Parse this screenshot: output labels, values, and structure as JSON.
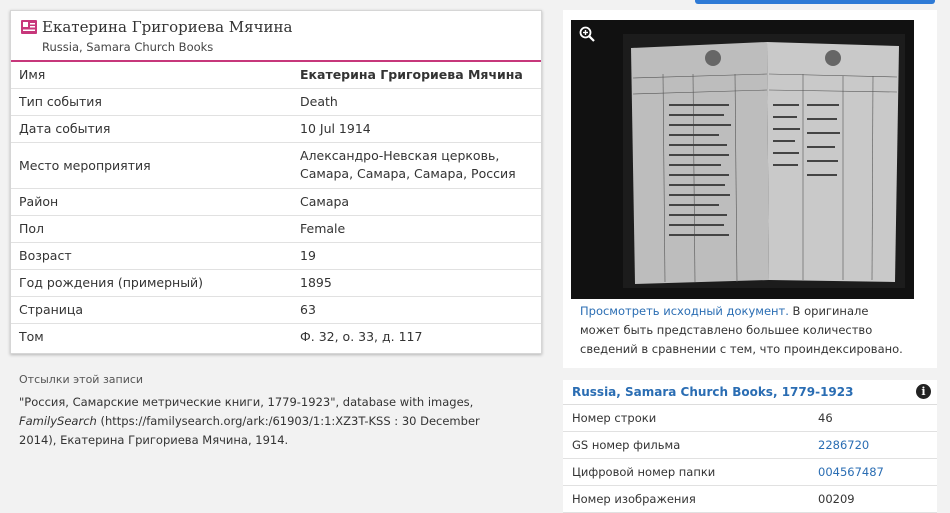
{
  "record": {
    "title": "Екатерина Григориева Мячина",
    "subtitle": "Russia, Samara Church Books",
    "fields": [
      {
        "label": "Имя",
        "value": "Екатерина Григориева Мячина"
      },
      {
        "label": "Тип события",
        "value": "Death"
      },
      {
        "label": "Дата события",
        "value": "10 Jul 1914"
      },
      {
        "label": "Место мероприятия",
        "value": "Александро-Невская церковь, Самара, Самара, Самара, Россия"
      },
      {
        "label": "Район",
        "value": "Самара"
      },
      {
        "label": "Пол",
        "value": "Female"
      },
      {
        "label": "Возраст",
        "value": "19"
      },
      {
        "label": "Год рождения (примерный)",
        "value": "1895"
      },
      {
        "label": "Страница",
        "value": "63"
      },
      {
        "label": "Том",
        "value": "Ф. 32, о. 33, д. 117"
      }
    ]
  },
  "citation": {
    "heading": "Отсылки этой записи",
    "part1": "\"Россия, Самарские метрические книги, 1779-1923\", database with images, ",
    "italic": "FamilySearch",
    "part2": " (https://familysearch.org/ark:/61903/1:1:XZ3T-KSS : 30 December 2014), Екатерина Григориева Мячина, 1914."
  },
  "image_panel": {
    "zoom_icon": "magnifier-plus-icon",
    "link": "Просмотреть исходный документ.",
    "note": " В оригинале может быть представлено большее количество сведений в сравнении с тем, что проиндексировано."
  },
  "collection": {
    "title": "Russia, Samara Church Books, 1779-1923",
    "info_icon": "info-icon",
    "rows": [
      {
        "label": "Номер строки",
        "value": "46",
        "link": false
      },
      {
        "label": "GS номер фильма",
        "value": "2286720",
        "link": true
      },
      {
        "label": "Цифровой номер папки",
        "value": "004567487",
        "link": true
      },
      {
        "label": "Номер изображения",
        "value": "00209",
        "link": false
      }
    ]
  },
  "colors": {
    "accent": "#c7377b",
    "link": "#2a6db3",
    "button": "#2f7bd6"
  }
}
